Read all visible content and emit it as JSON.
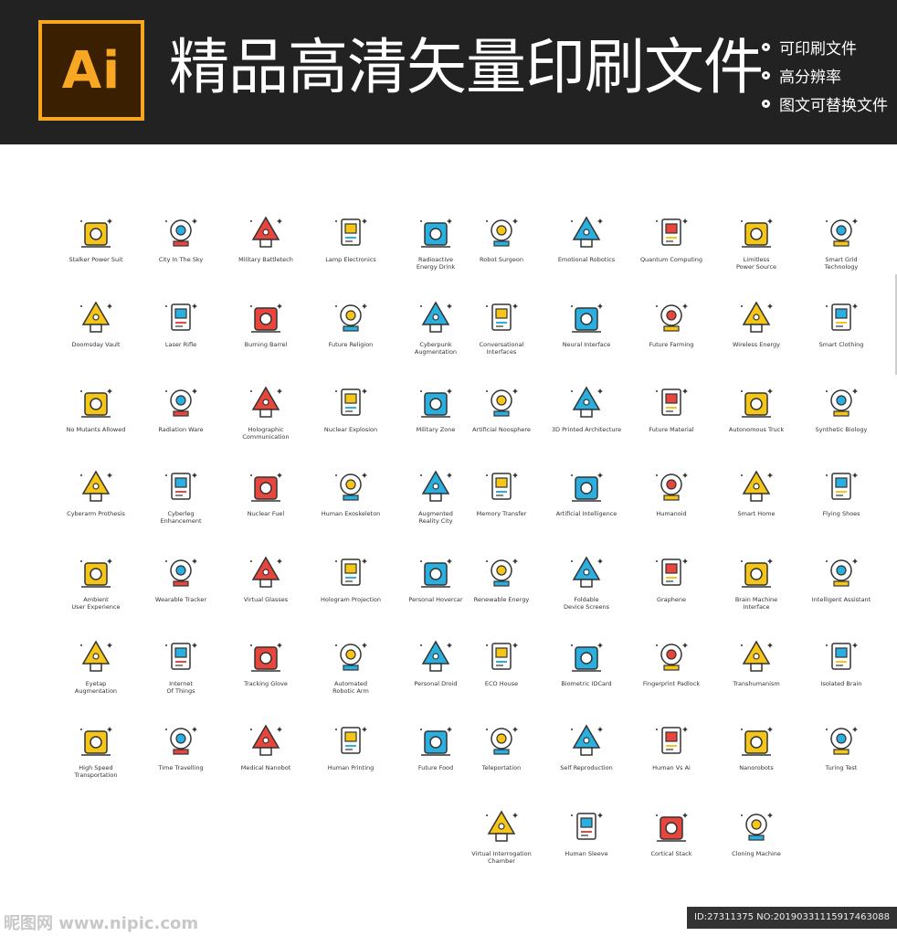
{
  "header": {
    "logo_text": "Ai",
    "title": "精品高清矢量印刷文件",
    "features": [
      "可印刷文件",
      "高分辨率",
      "图文可替换文件"
    ]
  },
  "colors": {
    "header_bg": "#222222",
    "logo_accent": "#F7A722",
    "icon_yellow": "#F5C518",
    "icon_blue": "#2AB0E0",
    "icon_red": "#E8453C",
    "outline": "#333333"
  },
  "icons": [
    {
      "label": "Stalker Power Suit",
      "icon": "power-suit-icon"
    },
    {
      "label": "City In The Sky",
      "icon": "sky-city-icon"
    },
    {
      "label": "Military Battletech",
      "icon": "battle-robot-icon"
    },
    {
      "label": "Lamp Electronics",
      "icon": "lamp-icon"
    },
    {
      "label": "Radioactive\nEnergy Drink",
      "icon": "energy-drink-icon"
    },
    {
      "label": "Robot Surgeon",
      "icon": "robot-arm-icon"
    },
    {
      "label": "Emotional Robotics",
      "icon": "robot-icon"
    },
    {
      "label": "Quantum Computing",
      "icon": "quantum-chip-icon"
    },
    {
      "label": "Limitless\nPower Source",
      "icon": "power-source-icon"
    },
    {
      "label": "Smart Grid\nTechnology",
      "icon": "grid-icon"
    },
    {
      "label": "Doomsday Vault",
      "icon": "vault-icon"
    },
    {
      "label": "Laser Rifle",
      "icon": "rifle-icon"
    },
    {
      "label": "Burning Barrel",
      "icon": "barrel-icon"
    },
    {
      "label": "Future Religion",
      "icon": "star-eye-icon"
    },
    {
      "label": "Cyberpunk\nAugmentation",
      "icon": "cyber-head-icon"
    },
    {
      "label": "Conversational\nInterfaces",
      "icon": "chat-phone-icon"
    },
    {
      "label": "Neural Interface",
      "icon": "brain-head-icon"
    },
    {
      "label": "Future Farming",
      "icon": "vertical-farm-icon"
    },
    {
      "label": "Wireless Energy",
      "icon": "wireless-battery-icon"
    },
    {
      "label": "Smart Clothing",
      "icon": "smart-shirt-icon"
    },
    {
      "label": "No Mutants Allowed",
      "icon": "warning-sign-icon"
    },
    {
      "label": "Radiation Ware",
      "icon": "radiation-hand-icon"
    },
    {
      "label": "Holographic\nCommunication",
      "icon": "hologram-globe-icon"
    },
    {
      "label": "Nuclear Explosion",
      "icon": "mushroom-cloud-icon"
    },
    {
      "label": "Military Zone",
      "icon": "military-badge-icon"
    },
    {
      "label": "Artificial Noosphere",
      "icon": "planet-orbit-icon"
    },
    {
      "label": "3D Printed Architecture",
      "icon": "3d-printer-icon"
    },
    {
      "label": "Future Material",
      "icon": "material-sheet-icon"
    },
    {
      "label": "Autonomous Truck",
      "icon": "truck-icon"
    },
    {
      "label": "Synthetic Biology",
      "icon": "leaf-icon"
    },
    {
      "label": "Cyberarm Prothesis",
      "icon": "cyber-arm-icon"
    },
    {
      "label": "Cyberleg\nEnhancement",
      "icon": "cyber-leg-icon"
    },
    {
      "label": "Nuclear Fuel",
      "icon": "fuel-can-icon"
    },
    {
      "label": "Human Exoskeleton",
      "icon": "exoskeleton-icon"
    },
    {
      "label": "Augmented\nReality City",
      "icon": "ar-city-icon"
    },
    {
      "label": "Memory Transfer",
      "icon": "two-heads-icon"
    },
    {
      "label": "Artificial Intelligence",
      "icon": "ai-head-icon"
    },
    {
      "label": "Humanoid",
      "icon": "humanoid-icon"
    },
    {
      "label": "Smart Home",
      "icon": "smart-home-icon"
    },
    {
      "label": "Flying Shoes",
      "icon": "flying-shoe-icon"
    },
    {
      "label": "Ambient\nUser Experience",
      "icon": "user-cycle-icon"
    },
    {
      "label": "Wearable Tracker",
      "icon": "ring-tracker-icon"
    },
    {
      "label": "Virtual Glasses",
      "icon": "vr-glasses-icon"
    },
    {
      "label": "Hologram Projection",
      "icon": "diamond-projector-icon"
    },
    {
      "label": "Personal Hovercar",
      "icon": "hovercar-icon"
    },
    {
      "label": "Renewable Energy",
      "icon": "energy-bulb-icon"
    },
    {
      "label": "Foldable\nDevice Screens",
      "icon": "foldable-phone-icon"
    },
    {
      "label": "Graphene",
      "icon": "hexagon-icon"
    },
    {
      "label": "Brain Machine\nInterface",
      "icon": "brain-monitor-icon"
    },
    {
      "label": "Intelligent Assistant",
      "icon": "assistant-robot-icon"
    },
    {
      "label": "Eyetap\nAugmentation",
      "icon": "eye-icon"
    },
    {
      "label": "Internet\nOf Things",
      "icon": "cloud-icon"
    },
    {
      "label": "Tracking Glove",
      "icon": "glove-icon"
    },
    {
      "label": "Automated\nRobotic Arm",
      "icon": "robotic-arm-icon"
    },
    {
      "label": "Personal Droid",
      "icon": "droid-icon"
    },
    {
      "label": "ECO House",
      "icon": "eco-house-icon"
    },
    {
      "label": "Biometric IDCard",
      "icon": "id-card-icon"
    },
    {
      "label": "Fingerprint Padlock",
      "icon": "padlock-icon"
    },
    {
      "label": "Transhumanism",
      "icon": "robot-hand-icon"
    },
    {
      "label": "Isolated Brain",
      "icon": "brain-jar-icon"
    },
    {
      "label": "High Speed\nTransportation",
      "icon": "train-station-icon"
    },
    {
      "label": "Time Travelling",
      "icon": "compass-icon"
    },
    {
      "label": "Medical Nanobot",
      "icon": "nanobot-icon"
    },
    {
      "label": "Human Printing",
      "icon": "print-head-icon"
    },
    {
      "label": "Future Food",
      "icon": "apple-icon"
    },
    {
      "label": "Teleportation",
      "icon": "teleport-booth-icon"
    },
    {
      "label": "Self Reproduction",
      "icon": "claw-machine-icon"
    },
    {
      "label": "Human Vs Ai",
      "icon": "chess-board-icon"
    },
    {
      "label": "Nanorobots",
      "icon": "nanorobots-icon"
    },
    {
      "label": "Turing Test",
      "icon": "turing-desk-icon"
    },
    {
      "label": "Virtual Interrogation\nChamber",
      "icon": "interrogation-chair-icon"
    },
    {
      "label": "Human Sleeve",
      "icon": "sleeve-pod-icon"
    },
    {
      "label": "Cortical Stack",
      "icon": "cortical-stack-icon"
    },
    {
      "label": "Cloning Machine",
      "icon": "cloning-tubes-icon"
    }
  ],
  "footer": {
    "watermark": "昵图网 www.nipic.com",
    "id_text": "ID:27311375 NO:20190331115917463088"
  }
}
